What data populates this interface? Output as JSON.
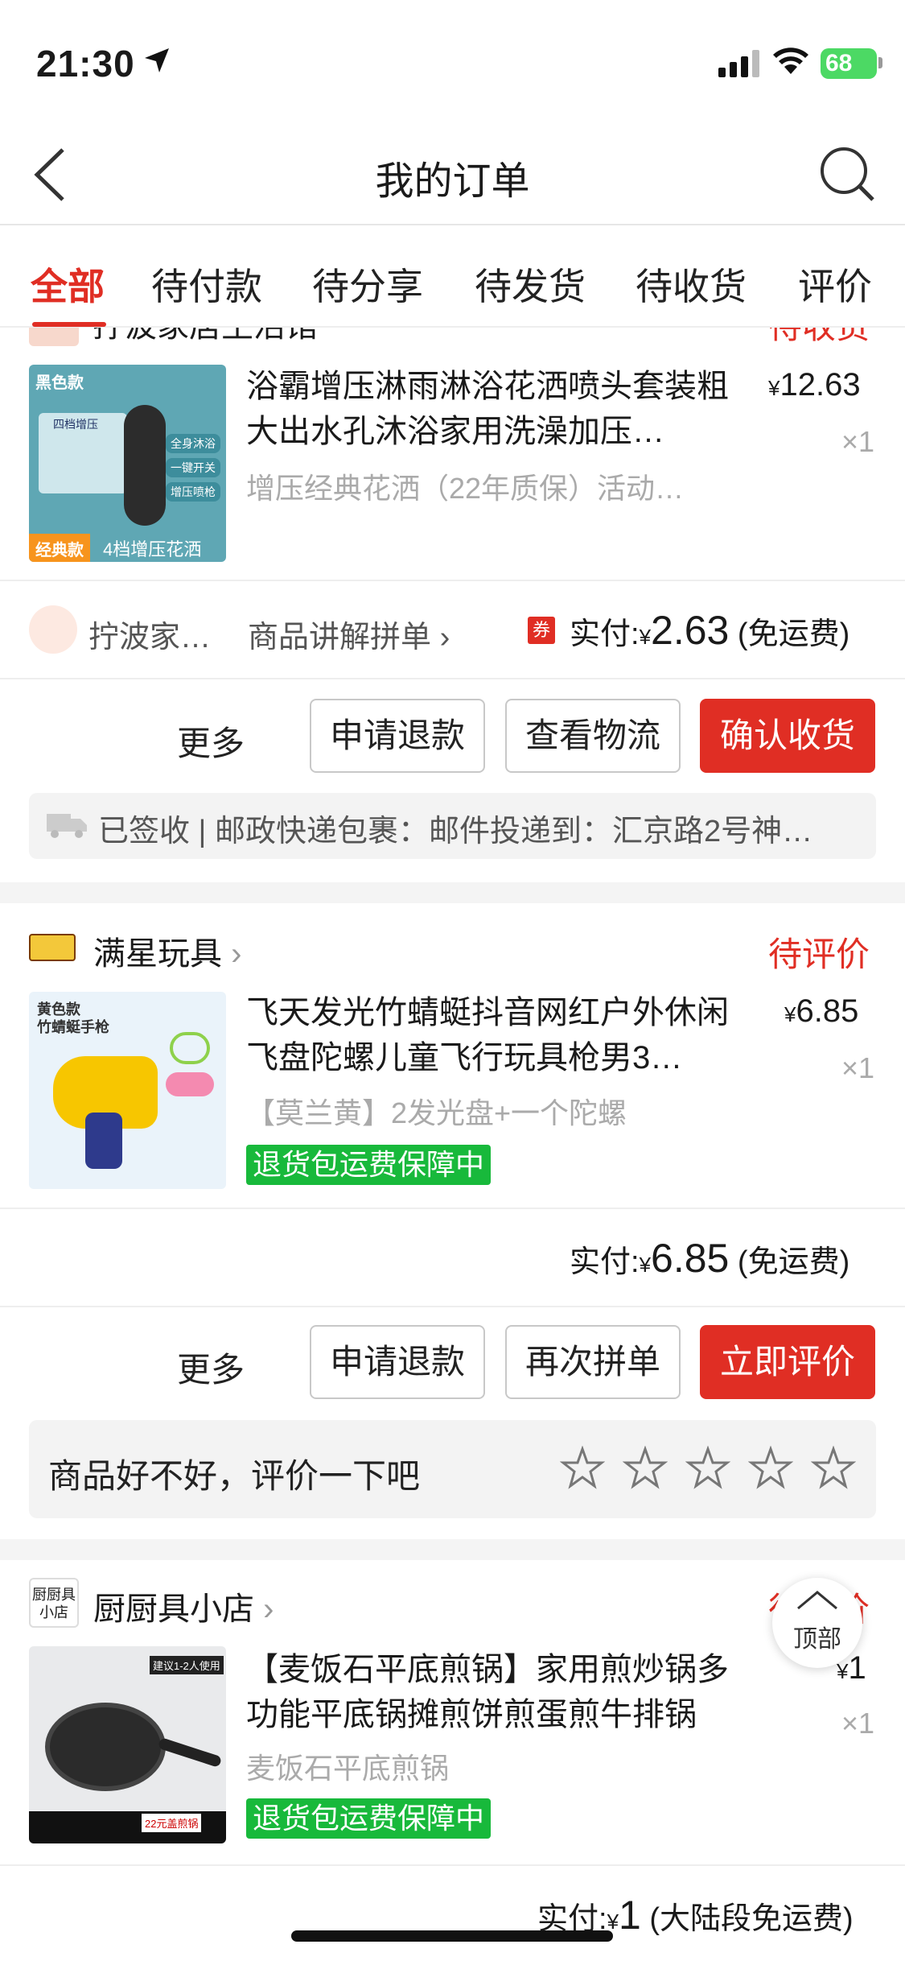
{
  "status_bar": {
    "time": "21:30",
    "battery": "68"
  },
  "nav": {
    "title": "我的订单"
  },
  "tabs": [
    "全部",
    "待付款",
    "待分享",
    "待发货",
    "待收货",
    "评价"
  ],
  "orders": [
    {
      "shop": "拧波家居生活馆",
      "status": "待收货",
      "title": "浴霸增压淋雨淋浴花洒喷头套装粗大出水孔沐浴家用洗澡加压…",
      "spec": "增压经典花洒（22年质保）活动…",
      "price_currency": "¥",
      "price": "12.63",
      "qty": "×1",
      "thumb_top": "黑色款",
      "thumb_feat": [
        "四档增压",
        "全身沐浴",
        "一键开关",
        "增压喷枪"
      ],
      "thumb_tag": "经典款",
      "thumb_sub": "4档增压花洒",
      "shop_short": "拧波家…",
      "group_link": "商品讲解拼单",
      "coupon": "券",
      "pay_label": "实付:",
      "pay_currency": "¥",
      "pay_amount": "2.63",
      "shipping": "(免运费)",
      "btn_more": "更多",
      "btn_refund": "申请退款",
      "btn_logistics": "查看物流",
      "btn_confirm": "确认收货",
      "logistics": "已签收 | 邮政快递包裹：邮件投递到：汇京路2号神…"
    },
    {
      "shop": "满星玩具",
      "status": "待评价",
      "title": "飞天发光竹蜻蜓抖音网红户外休闲飞盘陀螺儿童飞行玩具枪男3…",
      "spec": "【莫兰黄】2发光盘+一个陀螺",
      "price_currency": "¥",
      "price": "6.85",
      "qty": "×1",
      "thumb_top": "黄色款",
      "thumb_sub": "竹蜻蜓手枪",
      "badge": "退货包运费保障中",
      "pay_label": "实付:",
      "pay_currency": "¥",
      "pay_amount": "6.85",
      "shipping": "(免运费)",
      "btn_more": "更多",
      "btn_refund": "申请退款",
      "btn_regroup": "再次拼单",
      "btn_review": "立即评价",
      "review_prompt": "商品好不好，评价一下吧",
      "rating": 0,
      "rating_max": 5
    },
    {
      "shop": "厨厨具小店",
      "shop_logo": "厨厨具小店",
      "status": "待评价",
      "title": "【麦饭石平底煎锅】家用煎炒锅多功能平底锅摊煎饼煎蛋煎牛排锅",
      "spec": "麦饭石平底煎锅",
      "price_currency": "¥",
      "price": "1",
      "qty": "×1",
      "thumb_tag": "建议1-2人使用",
      "thumb_badge": "22元盖煎锅",
      "badge": "退货包运费保障中",
      "pay_label": "实付:",
      "pay_currency": "¥",
      "pay_amount": "1",
      "shipping": "(大陆段免运费)"
    }
  ],
  "top_button": "顶部"
}
